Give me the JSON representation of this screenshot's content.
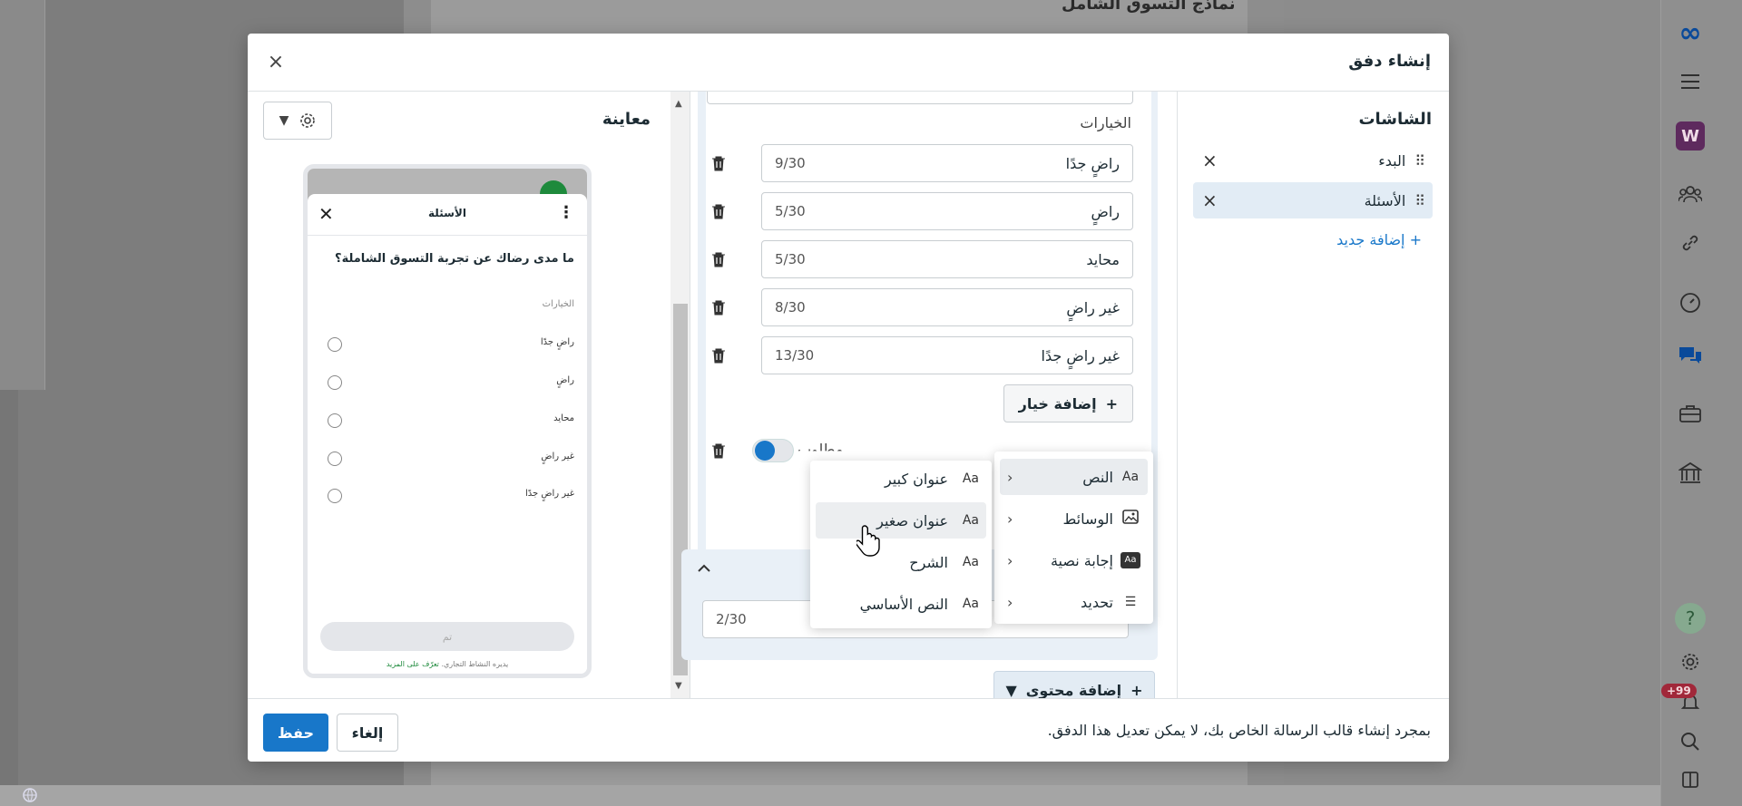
{
  "background": {
    "title": "نماذج التسوق الشامل"
  },
  "modal": {
    "title": "إنشاء دفق",
    "close_label": "×"
  },
  "screens": {
    "heading": "الشاشات",
    "items": [
      {
        "label": "البدء",
        "active": false
      },
      {
        "label": "الأسئلة",
        "active": true
      }
    ],
    "add_new": "+ إضافة جديد"
  },
  "editor": {
    "choices_label": "الخيارات",
    "options": [
      {
        "label": "راضٍ جدًا",
        "count": "9/30"
      },
      {
        "label": "راضٍ",
        "count": "5/30"
      },
      {
        "label": "محايد",
        "count": "5/30"
      },
      {
        "label": "غير راضٍ",
        "count": "8/30"
      },
      {
        "label": "غير راضٍ جدًا",
        "count": "13/30"
      }
    ],
    "add_option": "إضافة خيار",
    "required_label": "مطلوب",
    "second_count": "2/30",
    "add_content": "إضافة محتوى"
  },
  "menu": {
    "main_items": [
      {
        "icon": "Aa",
        "label": "النص",
        "icon_name": "text-icon"
      },
      {
        "icon": "🖼",
        "label": "الوسائط",
        "icon_name": "media-icon"
      },
      {
        "icon": "Aa",
        "label": "إجابة نصية",
        "icon_name": "text-answer-icon"
      },
      {
        "icon": "☰",
        "label": "تحديد",
        "icon_name": "selection-icon"
      }
    ],
    "sub_items": [
      {
        "icon": "Aa",
        "label": "عنوان كبير"
      },
      {
        "icon": "Aa",
        "label": "عنوان صغير"
      },
      {
        "icon": "Aa",
        "label": "الشرح"
      },
      {
        "icon": "Aa",
        "label": "النص الأساسي"
      }
    ]
  },
  "preview": {
    "title": "معاينة",
    "phone": {
      "header_title": "الأسئلة",
      "question": "ما مدى رضاك عن تجربة التسوق الشاملة؟",
      "choices_label": "الخيارات",
      "options": [
        "راضٍ جدًا",
        "راضٍ",
        "محايد",
        "غير راضٍ",
        "غير راضٍ جدًا"
      ],
      "done": "تم",
      "footer_text": "يديره النشاط التجاري.",
      "footer_link": "تعرّف على المزيد"
    }
  },
  "footer": {
    "note": "بمجرد إنشاء قالب الرسالة الخاص بك، لا يمكن تعديل هذا الدفق.",
    "cancel": "إلغاء",
    "save": "حفظ"
  },
  "rail": {
    "workspace_initial": "W",
    "notification_count": "+99",
    "help": "?"
  },
  "colors": {
    "accent": "#1877c9",
    "active_bg": "#e2ecf5",
    "card_bg": "#e9f0f7"
  }
}
